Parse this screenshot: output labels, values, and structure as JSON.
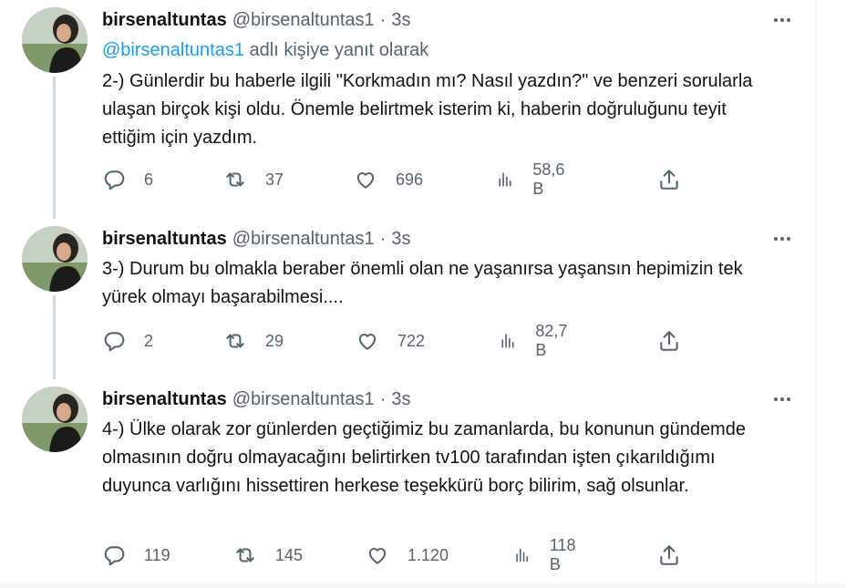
{
  "tweets": [
    {
      "name": "birsenaltuntas",
      "handle": "@birsenaltuntas1",
      "dot": "·",
      "time": "3s",
      "reply_to_handle": "@birsenaltuntas1",
      "reply_to_suffix": " adlı kişiye yanıt olarak",
      "text": "2-) Günlerdir bu haberle ilgili \"Korkmadın mı? Nasıl yazdın?\" ve benzeri sorularla ulaşan birçok kişi oldu. Önemle belirtmek isterim ki, haberin doğruluğunu teyit ettiğim için yazdım.",
      "replies": "6",
      "retweets": "37",
      "likes": "696",
      "views": "58,6 B"
    },
    {
      "name": "birsenaltuntas",
      "handle": "@birsenaltuntas1",
      "dot": "·",
      "time": "3s",
      "text": "3-) Durum bu olmakla beraber önemli olan ne yaşanırsa yaşansın hepimizin tek yürek olmayı başarabilmesi....",
      "replies": "2",
      "retweets": "29",
      "likes": "722",
      "views": "82,7 B"
    },
    {
      "name": "birsenaltuntas",
      "handle": "@birsenaltuntas1",
      "dot": "·",
      "time": "3s",
      "text": "4-) Ülke olarak zor günlerden geçtiğimiz bu zamanlarda, bu konunun gündemde olmasının doğru olmayacağını belirtirken tv100 tarafından işten çıkarıldığımı duyunca varlığını hissettiren herkese teşekkürü borç bilirim, sağ olsunlar.",
      "replies": "119",
      "retweets": "145",
      "likes": "1.120",
      "views": "118 B"
    }
  ],
  "icons": {
    "reply": "reply-icon",
    "retweet": "retweet-icon",
    "like": "heart-icon",
    "views": "views-icon",
    "share": "share-icon",
    "more": "more-icon"
  }
}
